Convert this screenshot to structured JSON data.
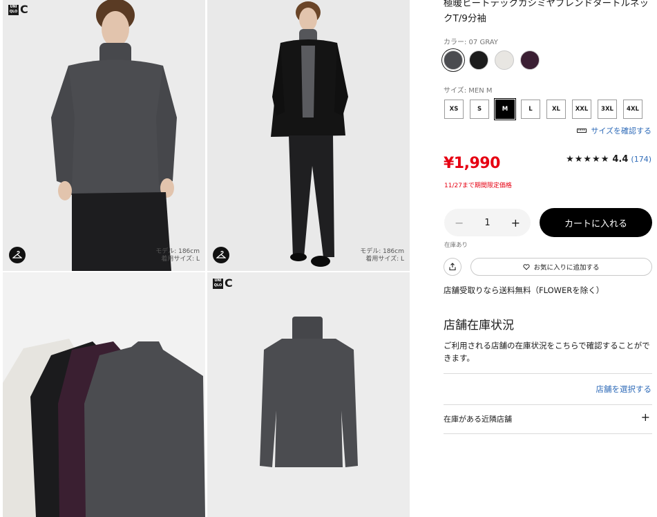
{
  "product": {
    "title": "極暖ヒートテックカシミヤブレンドタートルネックT/9分袖",
    "color_label": "カラー: 07 GRAY",
    "size_label": "サイズ: MEN M",
    "price": "¥1,990",
    "promo": "11/27まで期間限定価格",
    "rating_stars": "★★★★★",
    "rating_value": "4.4",
    "rating_count": "(174)",
    "size_check": "サイズを確認する"
  },
  "colors": [
    {
      "name": "gray",
      "hex": "#4b4c50",
      "selected": true
    },
    {
      "name": "black",
      "hex": "#1c1c1c",
      "selected": false
    },
    {
      "name": "off-white",
      "hex": "#e8e6e2",
      "selected": false
    },
    {
      "name": "wine",
      "hex": "#3b1f33",
      "selected": false
    }
  ],
  "sizes": [
    {
      "label": "XS",
      "selected": false
    },
    {
      "label": "S",
      "selected": false
    },
    {
      "label": "M",
      "selected": true
    },
    {
      "label": "L",
      "selected": false
    },
    {
      "label": "XL",
      "selected": false
    },
    {
      "label": "XXL",
      "selected": false
    },
    {
      "label": "3XL",
      "selected": false
    },
    {
      "label": "4XL",
      "selected": false
    }
  ],
  "cart": {
    "quantity": "1",
    "minus": "−",
    "plus": "+",
    "add_to_cart": "カートに入れる",
    "stock_status": "在庫あり",
    "favorite": "お気に入りに追加する"
  },
  "shipping": "店舗受取りなら送料無料（FLOWERを除く）",
  "store_stock": {
    "heading": "店舗在庫状況",
    "description": "ご利用される店舗の在庫状況をこちらで確認することができます。",
    "select_store": "店舗を選択する",
    "nearby": "在庫がある近隣店舗",
    "expand": "+"
  },
  "gallery": {
    "brand_letter": "C",
    "brand_square": "UNI QLO",
    "model_info_1": "モデル: 186cm",
    "model_info_2": "着用サイズ: L"
  },
  "colors_ui": {
    "accent_red": "#e60012",
    "link_blue": "#2f6bb8"
  }
}
